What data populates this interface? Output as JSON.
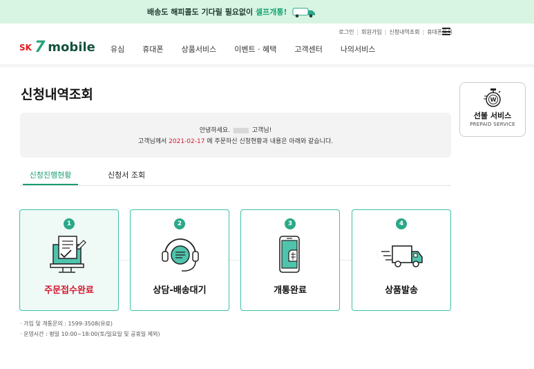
{
  "banner": {
    "text_pre": "배송도 해피콜도 기다릴 필요없이 ",
    "text_highlight": "셀프개통!",
    "colors": {
      "background": "#d8f4e3",
      "highlight": "#19a872"
    }
  },
  "utility_nav": [
    "로그인",
    "회원가입",
    "신청내역조회",
    "휴대폰등록"
  ],
  "logo": {
    "sk": "SK",
    "seven": "7",
    "mobile": "mobile"
  },
  "gnb": [
    "유심",
    "휴대폰",
    "상품서비스",
    "이벤트 · 혜택",
    "고객센터",
    "나의서비스"
  ],
  "page_title": "신청내역조회",
  "prepaid": {
    "title": "선불 서비스",
    "subtitle": "PREPAID SERVICE",
    "icon": "stopwatch-won-icon"
  },
  "greeting": {
    "line1_pre": "안녕하세요. ",
    "line1_post": " 고객님!",
    "line2_pre": "고객님께서 ",
    "date": "2021-02-17",
    "line2_post": " 에 주문하신 신청현황과 내용은 아래와 같습니다."
  },
  "tabs": [
    {
      "label": "신청진행현황",
      "active": true
    },
    {
      "label": "신청서 조회",
      "active": false
    }
  ],
  "steps": [
    {
      "number": "1",
      "label": "주문접수완료",
      "icon": "monitor-document-check-icon",
      "active": true
    },
    {
      "number": "2",
      "label": "상담-배송대기",
      "icon": "headset-chat-icon",
      "active": false
    },
    {
      "number": "3",
      "label": "개통완료",
      "icon": "phone-sim-icon",
      "active": false
    },
    {
      "number": "4",
      "label": "상품발송",
      "icon": "delivery-truck-icon",
      "active": false
    }
  ],
  "notes": [
    "· 가입 및 개통문의 : 1599-3508(유료)",
    "· 운영시간 : 평일 10:00~18:00(토/일요일 및 공휴일 제외)"
  ],
  "colors": {
    "accent": "#1a9c74",
    "active_step_text": "#d3162d",
    "card_border": "#3dbfa6"
  }
}
